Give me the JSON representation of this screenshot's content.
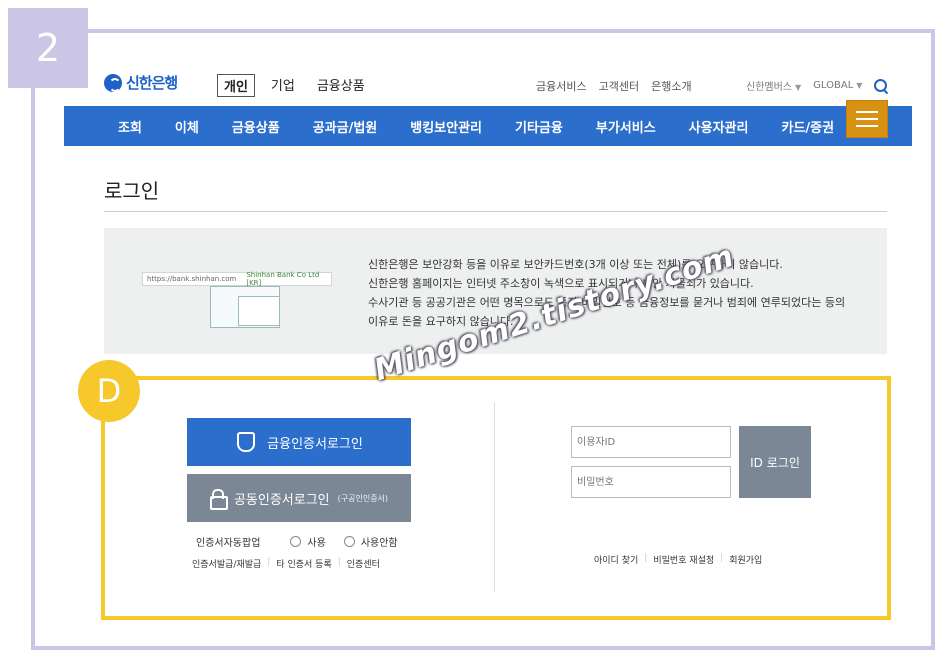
{
  "step": "2",
  "section_badge": "D",
  "header": {
    "logo": "신한은행",
    "tabs": [
      {
        "label": "개인",
        "active": true
      },
      {
        "label": "기업",
        "active": false
      },
      {
        "label": "금융상품",
        "active": false
      }
    ],
    "util_links": [
      "금융서비스",
      "고객센터",
      "은행소개"
    ],
    "family": "신한멤버스",
    "global": "GLOBAL"
  },
  "nav": [
    "조회",
    "이체",
    "금융상품",
    "공과금/법원",
    "뱅킹보안관리",
    "기타금융",
    "부가서비스",
    "사용자관리",
    "카드/증권"
  ],
  "page_title": "로그인",
  "notice": {
    "url": "https://bank.shinhan.com",
    "cert": "Shinhan Bank Co Ltd [KR]",
    "lines": [
      "신한은행은 보안강화 등을 이유로 보안카드번호(3개 이상 또는 전체)를 요구하지 않습니다.",
      "신한은행 홈페이지는 인터넷 주소창이 녹색으로 표시되거나 보안 자물쇠가 있습니다.",
      "수사기관 등 공공기관은 어떤 명목으로도 통장 비밀번호 등 금융정보를 묻거나 범죄에 연루되었다는 등의",
      "이유로 돈을 요구하지 않습니다."
    ]
  },
  "login": {
    "fin_cert_button": "금융인증서로그인",
    "public_cert_button": "공동인증서로그인",
    "public_cert_note": "(구공인인증서)",
    "auto_popup_label": "인증서자동팝업",
    "use": "사용",
    "no_use": "사용안함",
    "cert_links": [
      "인증서발급/재발급",
      "타 인증서 등록",
      "인증센터"
    ],
    "id_placeholder": "이용자ID",
    "pw_placeholder": "비밀번호",
    "id_login_button": "ID 로그인",
    "account_links": [
      "아이디 찾기",
      "비밀번호 재설정",
      "회원가입"
    ]
  },
  "watermark": "Mingom2.tistory.com",
  "colors": {
    "nav": "#2c6ecc",
    "menu": "#d99114",
    "highlight": "#f6c82b",
    "frame": "#cbc5e6"
  }
}
